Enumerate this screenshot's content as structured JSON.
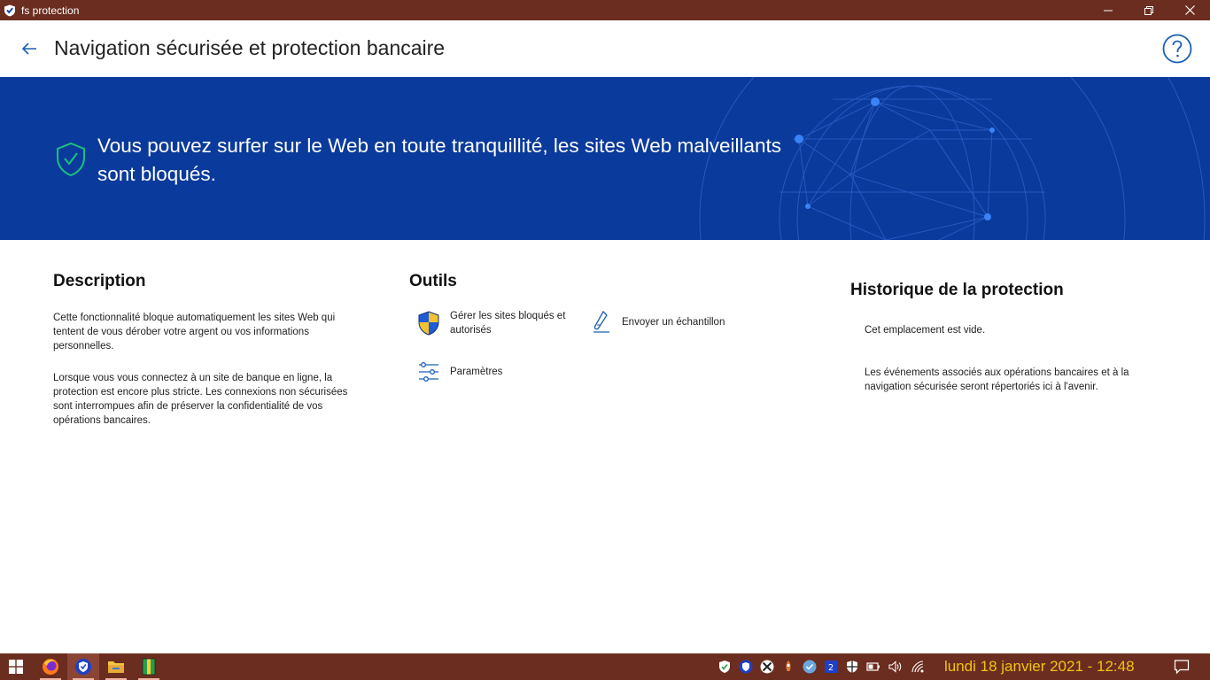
{
  "window": {
    "title": "fs protection",
    "controls": [
      "minimize-icon",
      "restore-icon",
      "close-icon"
    ]
  },
  "header": {
    "title": "Navigation sécurisée et protection bancaire",
    "back_icon": "back-arrow-icon",
    "help_icon": "help-icon"
  },
  "banner": {
    "message": "Vous pouvez surfer sur le Web en toute tranquillité, les sites Web malveillants sont bloqués.",
    "status_icon": "shield-check-icon",
    "background_color": "#0a3a9c"
  },
  "description": {
    "title": "Description",
    "paragraph1": "Cette fonctionnalité bloque automatiquement les sites Web qui tentent de vous dérober votre argent ou vos informations personnelles.",
    "paragraph2": "Lorsque vous vous connectez à un site de banque en ligne, la protection est encore plus stricte. Les connexions non sécurisées sont interrompues afin de préserver la confidentialité de vos opérations bancaires."
  },
  "tools": {
    "title": "Outils",
    "items": [
      {
        "label": "Gérer les sites bloqués et autorisés",
        "icon": "uac-shield-icon"
      },
      {
        "label": "Envoyer un échantillon",
        "icon": "sample-tube-icon"
      },
      {
        "label": "Paramètres",
        "icon": "sliders-icon"
      }
    ]
  },
  "history": {
    "title": "Historique de la protection",
    "empty": "Cet emplacement est vide.",
    "info": "Les événements associés aux opérations bancaires et à la navigation sécurisée seront répertoriés ici à l'avenir."
  },
  "taskbar": {
    "apps": [
      "windows-start-icon",
      "firefox-icon",
      "fs-protection-icon",
      "file-explorer-icon",
      "notepad-icon"
    ],
    "tray": [
      "shield-tray-icon",
      "fs-tray-icon",
      "xbox-tray-icon",
      "rocket-tray-icon",
      "check-tray-icon",
      "numbered-tray-icon",
      "security-tray-icon",
      "battery-icon",
      "volume-icon",
      "wifi-icon"
    ],
    "clock": "lundi 18 janvier 2021 - 12:48",
    "notification_icon": "notification-icon"
  }
}
